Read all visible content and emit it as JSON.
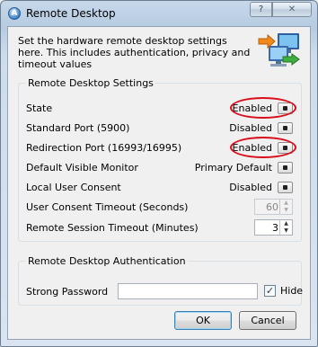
{
  "window": {
    "title": "Remote Desktop",
    "app_icon": "A",
    "help_glyph": "?",
    "close_glyph": "✕"
  },
  "intro": "Set the hardware remote desktop settings here. This includes authentication, privacy and timeout values",
  "hero_icon": "remote-desktop-illustration-icon",
  "settings": {
    "title": "Remote Desktop Settings",
    "rows": [
      {
        "label": "State",
        "value": "Enabled"
      },
      {
        "label": "Standard Port (5900)",
        "value": "Disabled"
      },
      {
        "label": "Redirection Port (16993/16995)",
        "value": "Enabled"
      },
      {
        "label": "Default Visible Monitor",
        "value": "Primary Default"
      },
      {
        "label": "Local User Consent",
        "value": "Disabled"
      }
    ],
    "consent_timeout": {
      "label": "User Consent Timeout (Seconds)",
      "value": "60",
      "enabled": false
    },
    "session_timeout": {
      "label": "Remote Session Timeout (Minutes)",
      "value": "3",
      "enabled": true
    }
  },
  "auth": {
    "title": "Remote Desktop Authentication",
    "password_label": "Strong Password",
    "password_value": "",
    "hide_label": "Hide",
    "hide_checked": true,
    "check_glyph": "✓"
  },
  "buttons": {
    "ok": "OK",
    "cancel": "Cancel"
  },
  "highlight_color": "#d80f1b"
}
